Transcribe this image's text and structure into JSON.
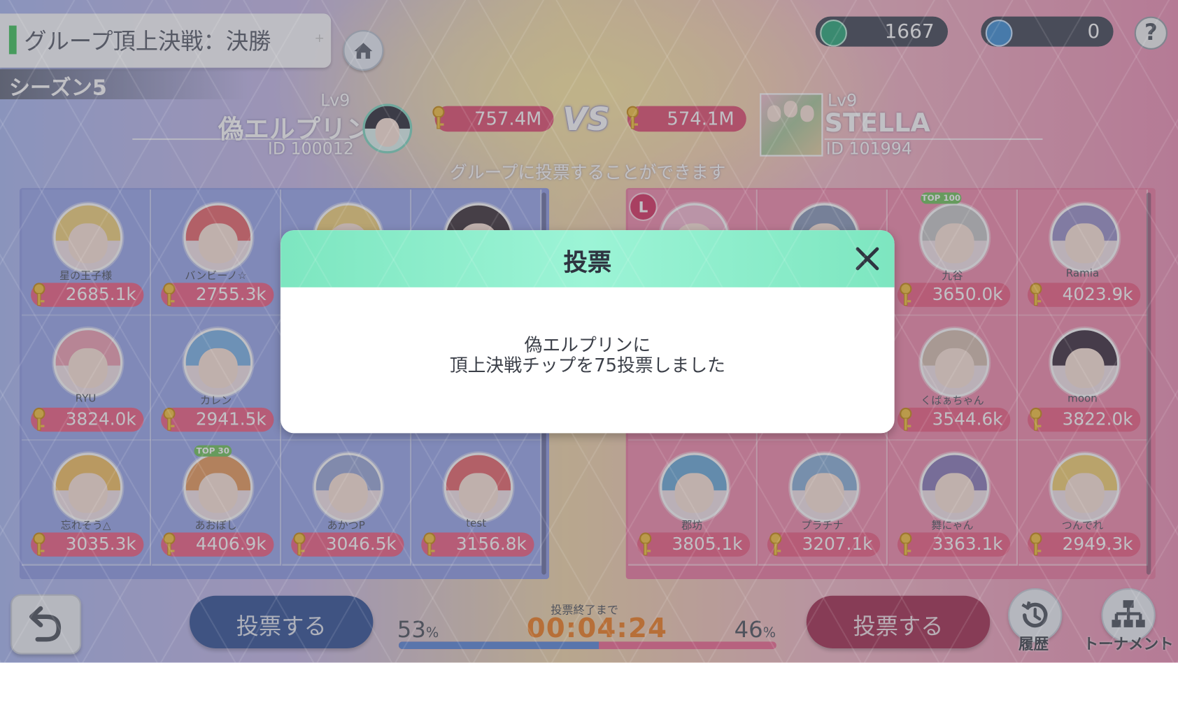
{
  "header": {
    "title": "グループ頂上決戦：決勝",
    "season": "シーズン5"
  },
  "currencies": [
    {
      "icon": "green-chip-icon",
      "value": "1667"
    },
    {
      "icon": "blue-chip-icon",
      "value": "0"
    }
  ],
  "match": {
    "left_team": {
      "level": "Lv9",
      "name": "偽エルプリン",
      "id": "ID 100012",
      "score": "757.4M"
    },
    "vs": "VS",
    "right_team": {
      "level": "Lv9",
      "name": "STELLA",
      "id": "ID 101994",
      "score": "574.1M"
    },
    "subtitle": "グループに投票することができます"
  },
  "left_members": [
    {
      "name": "星の王子様",
      "value": "2685.1k"
    },
    {
      "name": "バンビーノ☆",
      "value": "2755.3k"
    },
    {
      "name": "",
      "value": ""
    },
    {
      "name": "",
      "value": ""
    },
    {
      "name": "RYU",
      "value": "3824.0k"
    },
    {
      "name": "カレン",
      "value": "2941.5k"
    },
    {
      "name": "",
      "value": ""
    },
    {
      "name": "",
      "value": ""
    },
    {
      "name": "忘れそう△",
      "value": "3035.3k"
    },
    {
      "name": "あおぼし",
      "value": "4406.9k"
    },
    {
      "name": "あかつP",
      "value": "3046.5k"
    },
    {
      "name": "test",
      "value": "3156.8k"
    }
  ],
  "right_members": [
    {
      "name": "",
      "value": ""
    },
    {
      "name": "",
      "value": ""
    },
    {
      "name": "九谷",
      "value": "3650.0k"
    },
    {
      "name": "Ramia",
      "value": "4023.9k"
    },
    {
      "name": "",
      "value": ""
    },
    {
      "name": "",
      "value": ""
    },
    {
      "name": "くぱぁちゃん",
      "value": "3544.6k"
    },
    {
      "name": "moon",
      "value": "3822.0k"
    },
    {
      "name": "郡坊",
      "value": "3805.1k"
    },
    {
      "name": "プラチナ",
      "value": "3207.1k"
    },
    {
      "name": "舞にゃん",
      "value": "3363.1k"
    },
    {
      "name": "つんでれ",
      "value": "2949.3k"
    }
  ],
  "badges": {
    "leader": "L",
    "top100": "TOP 100",
    "top30": "TOP 30"
  },
  "bottom": {
    "vote_left": "投票する",
    "vote_right": "投票する",
    "timer_label": "投票終了まで",
    "timer": "00:04:24",
    "left_pct": "53",
    "right_pct": "46",
    "pct_unit": "%",
    "left_share": 0.53,
    "history_label": "履歴",
    "tournament_label": "トーナメント"
  },
  "dialog": {
    "title": "投票",
    "line1": "偽エルプリンに",
    "line2": "頂上決戦チップを75投票しました"
  },
  "colors": {
    "left_panel": "#8e9be6",
    "right_panel": "#ee7aa0",
    "vote_left_bg": "#2f4f95",
    "vote_right_bg": "#a32a4e",
    "accent_timer": "#f07c1e"
  }
}
